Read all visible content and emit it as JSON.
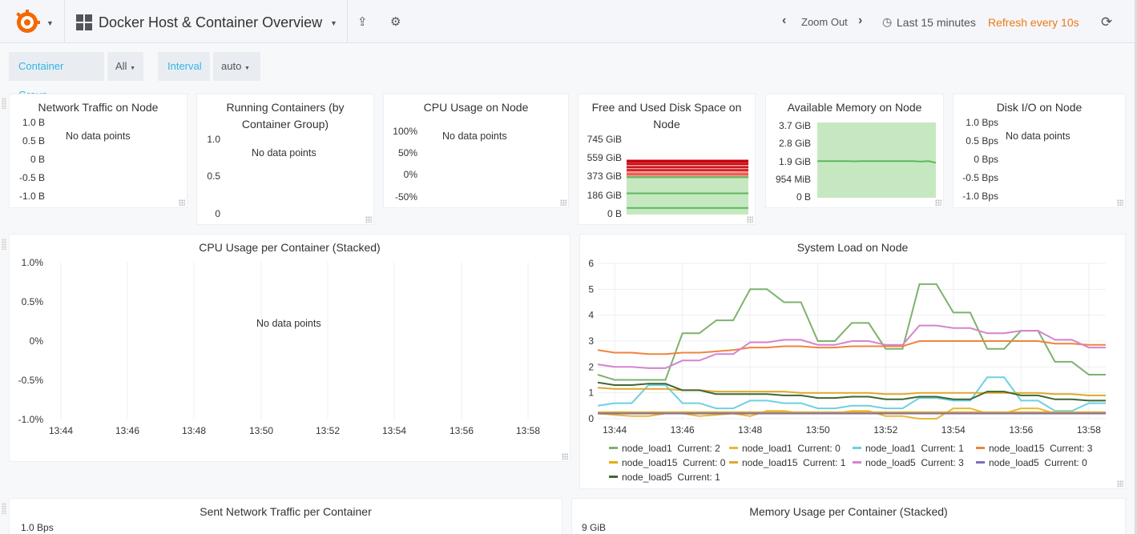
{
  "header": {
    "dashboard_title": "Docker Host & Container Overview",
    "zoom_out": "Zoom Out",
    "time_range": "Last 15 minutes",
    "refresh": "Refresh every 10s"
  },
  "variables": {
    "container_group_label": "Container Group",
    "container_group_value": "All",
    "interval_label": "Interval",
    "interval_value": "auto"
  },
  "colors": {
    "accent": "#33b5e5",
    "refresh_orange": "#eb7b18",
    "disk_used_red": "#c4000f",
    "disk_fill_red": "#f3988f",
    "memory_green": "#5cb85c",
    "memory_fill": "#c6e8c0"
  },
  "nodata_text": "No data points",
  "panels": {
    "network_traffic": {
      "title": "Network Traffic on Node",
      "yticks": [
        "1.0 B",
        "0.5 B",
        "0 B",
        "-0.5 B",
        "-1.0 B"
      ]
    },
    "running_containers": {
      "title": "Running Containers (by Container Group)",
      "yticks": [
        "1.0",
        "0.5",
        "0"
      ]
    },
    "cpu_usage_node": {
      "title": "CPU Usage on Node",
      "yticks": [
        "100%",
        "50%",
        "0%",
        "-50%"
      ]
    },
    "disk_space": {
      "title": "Free and Used Disk Space on Node",
      "yticks": [
        "745 GiB",
        "559 GiB",
        "373 GiB",
        "186 GiB",
        "0 B"
      ]
    },
    "available_memory": {
      "title": "Available Memory on Node",
      "yticks": [
        "3.7 GiB",
        "2.8 GiB",
        "1.9 GiB",
        "954 MiB",
        "0 B"
      ]
    },
    "disk_io": {
      "title": "Disk I/O on Node",
      "yticks": [
        "1.0 Bps",
        "0.5 Bps",
        "0 Bps",
        "-0.5 Bps",
        "-1.0 Bps"
      ]
    },
    "cpu_per_container": {
      "title": "CPU Usage per Container (Stacked)",
      "yticks": [
        "1.0%",
        "0.5%",
        "0%",
        "-0.5%",
        "-1.0%"
      ],
      "xticks": [
        "13:44",
        "13:46",
        "13:48",
        "13:50",
        "13:52",
        "13:54",
        "13:56",
        "13:58"
      ]
    },
    "system_load": {
      "title": "System Load on Node"
    },
    "sent_network": {
      "title": "Sent Network Traffic per Container",
      "first_ytick": "1.0 Bps"
    },
    "memory_per_container": {
      "title": "Memory Usage per Container (Stacked)",
      "first_ytick": "9 GiB"
    }
  },
  "chart_data": [
    {
      "type": "area",
      "title": "Free and Used Disk Space on Node",
      "yticks": [
        "745 GiB",
        "559 GiB",
        "373 GiB",
        "186 GiB",
        "0 B"
      ],
      "ylim": [
        0,
        745
      ],
      "y_unit": "GiB",
      "bands": [
        {
          "name": "used",
          "color": "#f3988f",
          "from": 373,
          "to": 535
        },
        {
          "name": "free",
          "color": "#c6e8c0",
          "from": 0,
          "to": 373
        }
      ],
      "lines": [
        {
          "color": "#c4000f",
          "value": 535
        },
        {
          "color": "#c4000f",
          "value": 520
        },
        {
          "color": "#c4000f",
          "value": 500
        },
        {
          "color": "#c4000f",
          "value": 470
        },
        {
          "color": "#c4000f",
          "value": 440
        },
        {
          "color": "#e24d42",
          "value": 400
        },
        {
          "color": "#5cb85c",
          "value": 370
        },
        {
          "color": "#5cb85c",
          "value": 210
        },
        {
          "color": "#5cb85c",
          "value": 65
        }
      ]
    },
    {
      "type": "area",
      "title": "Available Memory on Node",
      "yticks": [
        "3.7 GiB",
        "2.8 GiB",
        "1.9 GiB",
        "954 MiB",
        "0 B"
      ],
      "ylim": [
        0,
        3.7
      ],
      "y_unit": "GiB",
      "band": {
        "from": 0,
        "to": 3.7,
        "color": "#c6e8c0"
      },
      "line": {
        "color": "#5cb85c",
        "values": [
          1.8,
          1.8,
          1.8,
          1.8,
          1.8,
          1.79,
          1.8,
          1.8,
          1.8,
          1.8,
          1.8,
          1.8,
          1.8,
          1.8,
          1.78,
          1.8,
          1.72
        ]
      }
    },
    {
      "type": "line",
      "title": "System Load on Node",
      "ylim": [
        0,
        6
      ],
      "yticks": [
        "6",
        "5",
        "4",
        "3",
        "2",
        "1",
        "0"
      ],
      "xticks": [
        "13:44",
        "13:46",
        "13:48",
        "13:50",
        "13:52",
        "13:54",
        "13:56",
        "13:58"
      ],
      "x": [
        "13:43:30",
        "13:44:00",
        "13:44:30",
        "13:45:00",
        "13:45:30",
        "13:46:00",
        "13:46:30",
        "13:47:00",
        "13:47:30",
        "13:48:00",
        "13:48:30",
        "13:49:00",
        "13:49:30",
        "13:50:00",
        "13:50:30",
        "13:51:00",
        "13:51:30",
        "13:52:00",
        "13:52:30",
        "13:53:00",
        "13:53:30",
        "13:54:00",
        "13:54:30",
        "13:55:00",
        "13:55:30",
        "13:56:00",
        "13:56:30",
        "13:57:00",
        "13:57:30",
        "13:58:00",
        "13:58:30"
      ],
      "series": [
        {
          "name": "node_load1",
          "current": "Current: 2",
          "color": "#7eb26d",
          "values": [
            1.7,
            1.5,
            1.5,
            1.5,
            1.5,
            3.3,
            3.3,
            3.8,
            3.8,
            5.0,
            5.0,
            4.5,
            4.5,
            3.0,
            3.0,
            3.7,
            3.7,
            2.7,
            2.7,
            5.2,
            5.2,
            4.1,
            4.1,
            2.7,
            2.7,
            3.4,
            3.4,
            2.2,
            2.2,
            1.7,
            1.7
          ]
        },
        {
          "name": "node_load1",
          "current": "Current: 0",
          "color": "#eab839",
          "values": [
            0.2,
            0.15,
            0.1,
            0.1,
            0.2,
            0.2,
            0.1,
            0.15,
            0.2,
            0.1,
            0.3,
            0.3,
            0.2,
            0.2,
            0.2,
            0.3,
            0.3,
            0.1,
            0.1,
            0.0,
            0.0,
            0.4,
            0.4,
            0.2,
            0.2,
            0.4,
            0.4,
            0.2,
            0.2,
            0.2,
            0.2
          ]
        },
        {
          "name": "node_load1",
          "current": "Current: 1",
          "color": "#6ed0e0",
          "values": [
            0.5,
            0.6,
            0.6,
            1.3,
            1.3,
            0.6,
            0.6,
            0.4,
            0.4,
            0.7,
            0.7,
            0.6,
            0.6,
            0.4,
            0.4,
            0.5,
            0.5,
            0.4,
            0.4,
            0.8,
            0.8,
            0.7,
            0.7,
            1.6,
            1.6,
            0.7,
            0.7,
            0.3,
            0.3,
            0.6,
            0.6
          ]
        },
        {
          "name": "node_load15",
          "current": "Current: 3",
          "color": "#ef843c",
          "values": [
            2.65,
            2.55,
            2.55,
            2.5,
            2.5,
            2.55,
            2.55,
            2.6,
            2.65,
            2.75,
            2.75,
            2.8,
            2.8,
            2.75,
            2.75,
            2.8,
            2.8,
            2.8,
            2.8,
            3.0,
            3.0,
            3.0,
            3.0,
            3.0,
            3.0,
            3.0,
            3.0,
            2.9,
            2.9,
            2.85,
            2.85
          ]
        },
        {
          "name": "node_load15",
          "current": "Current: 0",
          "color": "#e5ac0e",
          "values": [
            0.25,
            0.25,
            0.25,
            0.25,
            0.25,
            0.25,
            0.25,
            0.25,
            0.25,
            0.25,
            0.25,
            0.25,
            0.25,
            0.25,
            0.25,
            0.25,
            0.25,
            0.25,
            0.25,
            0.25,
            0.25,
            0.25,
            0.25,
            0.25,
            0.25,
            0.25,
            0.25,
            0.25,
            0.25,
            0.25,
            0.25
          ]
        },
        {
          "name": "node_load15",
          "current": "Current: 1",
          "color": "#e0a92c",
          "values": [
            1.2,
            1.15,
            1.15,
            1.15,
            1.15,
            1.1,
            1.1,
            1.05,
            1.05,
            1.05,
            1.05,
            1.05,
            1.0,
            1.0,
            1.0,
            1.0,
            1.0,
            0.95,
            0.95,
            1.0,
            1.0,
            1.0,
            1.0,
            1.0,
            1.0,
            1.0,
            1.0,
            0.95,
            0.95,
            0.9,
            0.9
          ]
        },
        {
          "name": "node_load5",
          "current": "Current: 3",
          "color": "#d683ce",
          "values": [
            2.1,
            2.0,
            2.0,
            1.95,
            1.95,
            2.25,
            2.25,
            2.5,
            2.5,
            2.95,
            2.95,
            3.05,
            3.05,
            2.85,
            2.85,
            3.0,
            3.0,
            2.85,
            2.85,
            3.6,
            3.6,
            3.5,
            3.5,
            3.3,
            3.3,
            3.4,
            3.4,
            3.05,
            3.05,
            2.75,
            2.75
          ]
        },
        {
          "name": "node_load5",
          "current": "Current: 0",
          "color": "#806eb7",
          "values": [
            0.2,
            0.2,
            0.2,
            0.2,
            0.2,
            0.2,
            0.2,
            0.2,
            0.2,
            0.2,
            0.2,
            0.2,
            0.2,
            0.2,
            0.2,
            0.2,
            0.2,
            0.2,
            0.2,
            0.2,
            0.2,
            0.2,
            0.2,
            0.2,
            0.2,
            0.2,
            0.2,
            0.2,
            0.2,
            0.2,
            0.2
          ]
        },
        {
          "name": "node_load5",
          "current": "Current: 1",
          "color": "#3f6833",
          "values": [
            1.4,
            1.3,
            1.3,
            1.35,
            1.35,
            1.1,
            1.1,
            0.95,
            0.95,
            0.95,
            0.95,
            0.9,
            0.9,
            0.8,
            0.8,
            0.85,
            0.85,
            0.75,
            0.75,
            0.85,
            0.85,
            0.75,
            0.75,
            1.05,
            1.05,
            0.9,
            0.9,
            0.75,
            0.75,
            0.7,
            0.7
          ]
        }
      ]
    }
  ]
}
